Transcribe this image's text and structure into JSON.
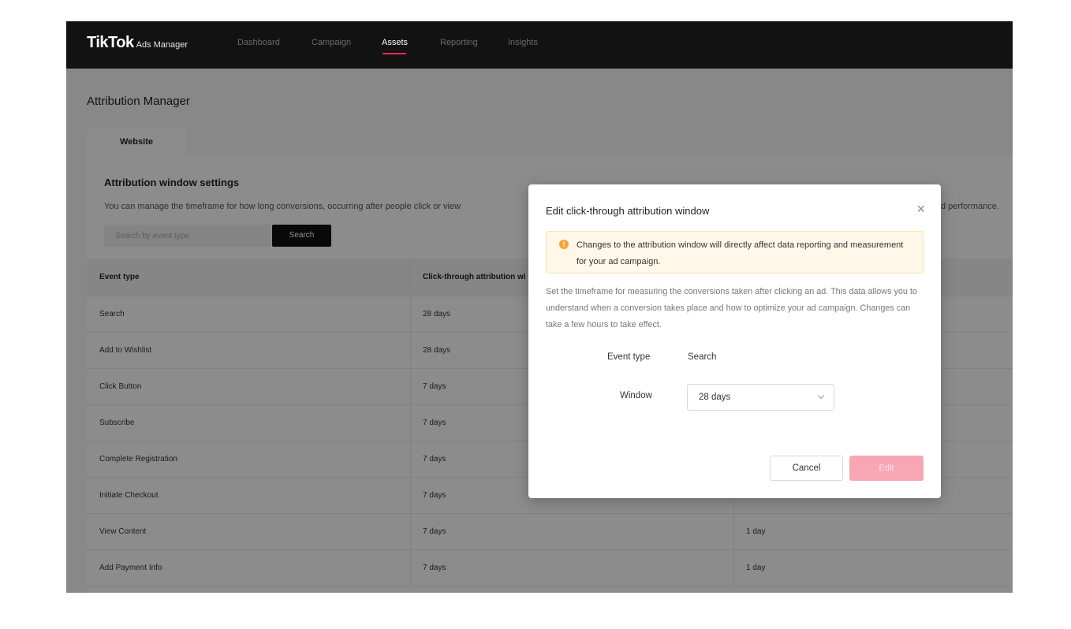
{
  "nav": {
    "brand": "TikTok",
    "brand_sub": "Ads Manager",
    "items": [
      "Dashboard",
      "Campaign",
      "Assets",
      "Reporting",
      "Insights"
    ],
    "active": "Assets"
  },
  "page": {
    "title": "Attribution Manager",
    "tab": "Website",
    "section_title": "Attribution window settings",
    "section_desc": "You can manage the timeframe for how long conversions, occurring after people click or view",
    "section_desc_tail": "d performance.",
    "search_placeholder": "Search by event type",
    "search_button": "Search"
  },
  "table": {
    "headers": [
      "Event type",
      "Click-through attribution wi",
      ""
    ],
    "rows": [
      {
        "event": "Search",
        "click": "28 days",
        "view": ""
      },
      {
        "event": "Add to Wishlist",
        "click": "28 days",
        "view": ""
      },
      {
        "event": "Click Button",
        "click": "7 days",
        "view": ""
      },
      {
        "event": "Subscribe",
        "click": "7 days",
        "view": ""
      },
      {
        "event": "Complete Registration",
        "click": "7 days",
        "view": ""
      },
      {
        "event": "Initiate Checkout",
        "click": "7 days",
        "view": ""
      },
      {
        "event": "View Content",
        "click": "7 days",
        "view": "1 day"
      },
      {
        "event": "Add Payment Info",
        "click": "7 days",
        "view": "1 day"
      }
    ]
  },
  "modal": {
    "title": "Edit click-through attribution window",
    "close": "×",
    "alert_icon": "!",
    "alert": "Changes to the attribution window will directly affect data reporting and measurement for your ad campaign.",
    "description": "Set the timeframe for measuring the conversions taken after clicking an ad. This data allows you to understand when a conversion takes place and how to optimize your ad campaign. Changes can take a few hours to take effect.",
    "event_type_label": "Event type",
    "event_type_value": "Search",
    "window_label": "Window",
    "window_value": "28 days",
    "cancel": "Cancel",
    "edit": "Edit"
  },
  "colors": {
    "nav_bg": "#121212",
    "accent": "#fe2c55",
    "edit_disabled": "#f8a6b4",
    "alert_bg": "#fff7e8",
    "alert_icon": "#f6a53a"
  }
}
